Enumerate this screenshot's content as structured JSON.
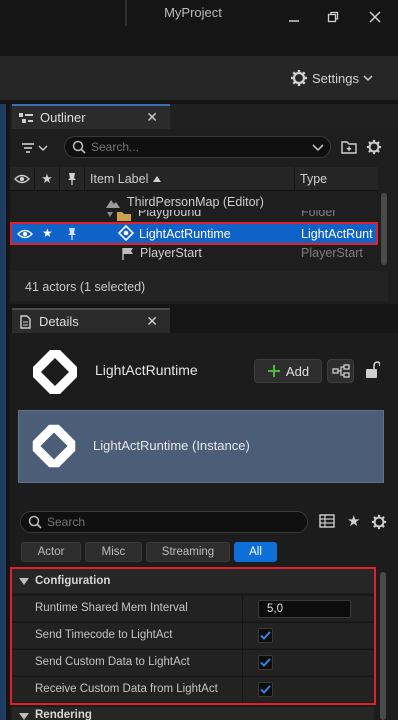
{
  "window": {
    "title": "MyProject"
  },
  "toolbar": {
    "settings_label": "Settings"
  },
  "outliner": {
    "tab_label": "Outliner",
    "search_placeholder": "Search...",
    "columns": {
      "item_label": "Item Label",
      "type": "Type"
    },
    "rows": [
      {
        "label": "ThirdPersonMap (Editor)",
        "type": ""
      },
      {
        "label": "Playground",
        "type": "Folder"
      },
      {
        "label": "LightActRuntime",
        "type": "LightActRunt"
      },
      {
        "label": "PlayerStart",
        "type": "PlayerStart"
      }
    ],
    "status": "41 actors (1 selected)"
  },
  "details": {
    "tab_label": "Details",
    "actor_name": "LightActRuntime",
    "add_label": "Add",
    "instance_label": "LightActRuntime (Instance)",
    "search_placeholder": "Search",
    "filters": [
      "Actor",
      "Misc",
      "Streaming",
      "All"
    ],
    "sections": {
      "configuration": {
        "title": "Configuration",
        "properties": [
          {
            "label": "Runtime Shared Mem Interval",
            "value": "5,0"
          },
          {
            "label": "Send Timecode to LightAct",
            "checked": true
          },
          {
            "label": "Send Custom Data to LightAct",
            "checked": true
          },
          {
            "label": "Receive Custom Data from LightAct",
            "checked": true
          }
        ]
      },
      "rendering": {
        "title": "Rendering"
      }
    }
  },
  "colors": {
    "accent": "#0f6fd9",
    "selection": "#0f63c8",
    "highlight_border": "#e0212b",
    "instance_bg": "#4b5d77"
  }
}
